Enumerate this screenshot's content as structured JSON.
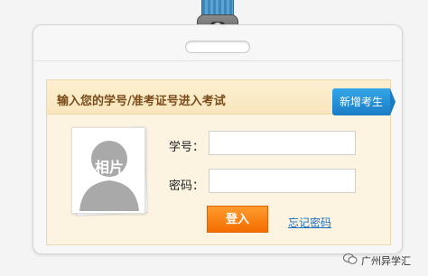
{
  "panel": {
    "title": "输入您的学号/准考证号进入考试",
    "new_student_button": "新增考生"
  },
  "photo": {
    "placeholder_text": "相片",
    "icon": "person-silhouette-icon"
  },
  "form": {
    "student_id_label": "学号：",
    "student_id_value": "",
    "password_label": "密码：",
    "password_value": ""
  },
  "actions": {
    "login_label": "登入",
    "forgot_password_label": "忘记密码"
  },
  "watermark": {
    "icon": "wechat-icon",
    "text": "广州异学汇"
  },
  "colors": {
    "panel_background": "#fcf4e1",
    "title_text": "#7a4c1c",
    "login_button": "#f46d00",
    "new_student_button": "#1a7cc6",
    "link": "#1a6fbf"
  }
}
